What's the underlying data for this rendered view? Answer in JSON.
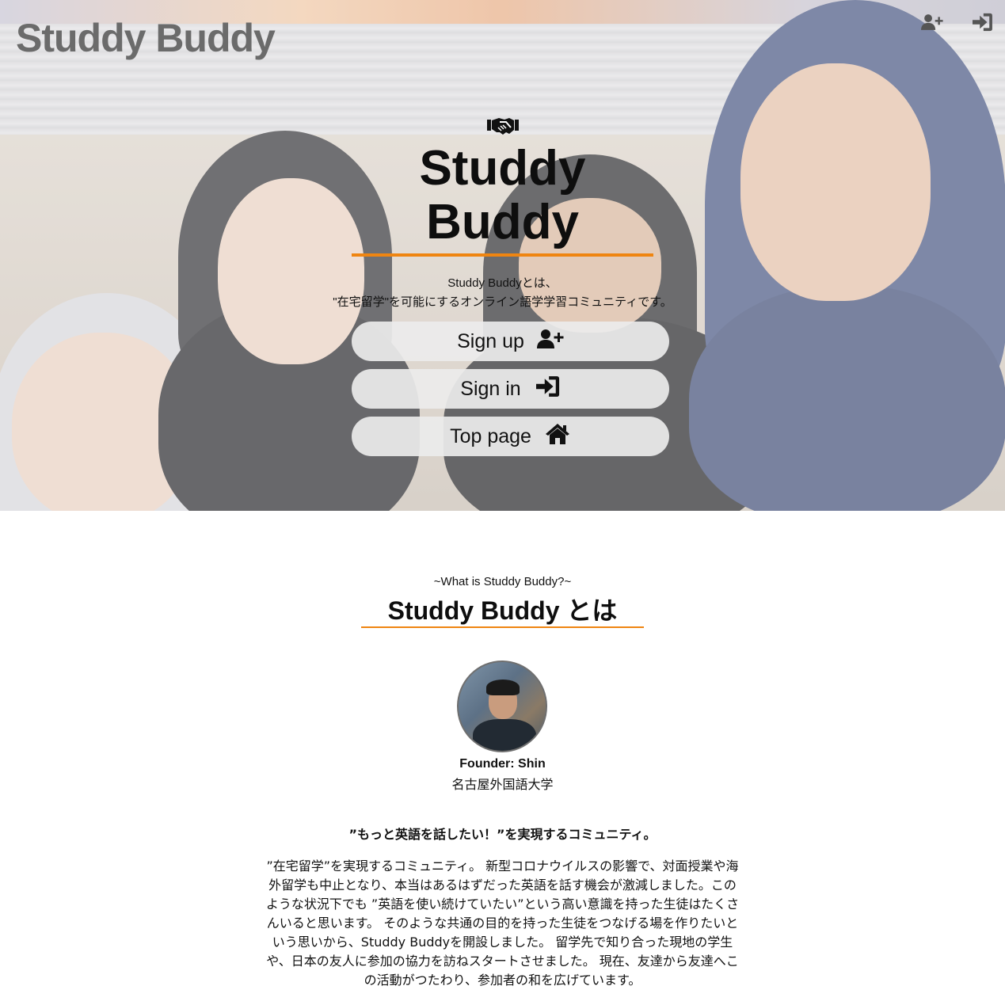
{
  "header": {
    "brand": "Studdy Buddy",
    "icons": [
      "user-plus-icon",
      "sign-in-icon"
    ]
  },
  "hero": {
    "icon": "handshake-icon",
    "title_line1": "Studdy",
    "title_line2": "Buddy",
    "desc_line1": "Studdy Buddyとは、",
    "desc_line2": "\"在宅留学\"を可能にするオンライン語学学習コミュニティです。",
    "buttons": {
      "signup": "Sign up",
      "signin": "Sign in",
      "top": "Top page"
    }
  },
  "about": {
    "subtitle": "~What is Studdy Buddy?~",
    "title": "Studdy Buddy とは",
    "founder": "Founder: Shin",
    "school": "名古屋外国語大学",
    "catchphrase": "”もっと英語を話したい！”を実現するコミュニティ。",
    "story": "”在宅留学”を実現するコミュニティ。 新型コロナウイルスの影響で、対面授業や海外留学も中止となり、本当はあるはずだった英語を話す機会が激減しました。このような状況下でも ”英語を使い続けていたい”という高い意識を持った生徒はたくさんいると思います。 そのような共通の目的を持った生徒をつなげる場を作りたいという思いから、Studdy Buddyを開設しました。 留学先で知り合った現地の学生や、日本の友人に参加の協力を訪ねスタートさせました。 現在、友達から友達へこの活動がつたわり、参加者の和を広げています。"
  },
  "colors": {
    "accent": "#ef8511",
    "button_bg": "#ececec",
    "brand_text": "#6b6b6b"
  }
}
